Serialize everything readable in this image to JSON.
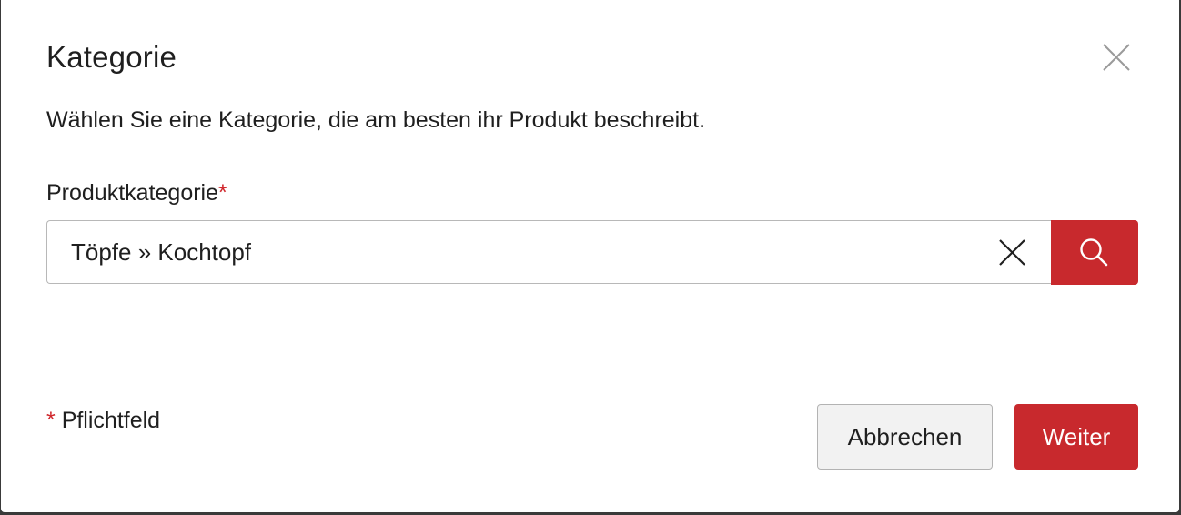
{
  "dialog": {
    "title": "Kategorie",
    "description": "Wählen Sie eine Kategorie, die am besten ihr Produkt beschreibt."
  },
  "field": {
    "label": "Produktkategorie",
    "required_marker": "*",
    "value": "Töpfe » Kochtopf"
  },
  "footer": {
    "required_marker": "*",
    "required_note": "Pflichtfeld",
    "cancel_label": "Abbrechen",
    "next_label": "Weiter"
  },
  "icons": {
    "close": "close-icon",
    "clear": "clear-icon",
    "search": "search-icon"
  },
  "colors": {
    "accent": "#c8292d",
    "required": "#d0272c",
    "secondary_button_bg": "#f2f2f2"
  }
}
